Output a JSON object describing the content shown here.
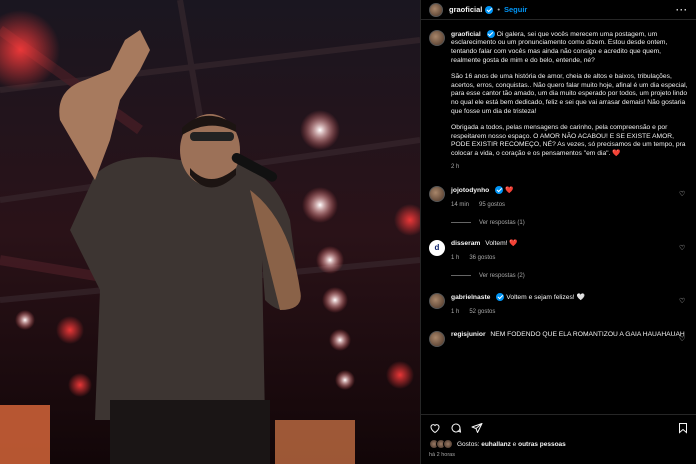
{
  "header": {
    "username": "graoficial",
    "separator": "•",
    "follow_label": "Seguir",
    "more_label": "···"
  },
  "caption": {
    "username": "graoficial",
    "paragraphs": [
      "Oi galera, sei que vocês merecem uma postagem, um esclarecimento ou um pronunciamento como dizem. Estou desde ontem, tentando falar com vocês mas ainda não consigo e acredito que quem, realmente gosta de mim e do belo, entende, né?",
      "São 16 anos de uma história de amor, cheia de altos e baixos, tribulações, acertos, erros, conquistas.. Não quero falar muito hoje, afinal é um dia especial, para esse cantor tão amado, um dia muito esperado por todos, um projeto lindo no qual ele está bem dedicado, feliz e sei que vai arrasar demais! Não gostaria que fosse um dia de tristeza!",
      "Obrigada a todos, pelas mensagens de carinho, pela compreensão e por respeitarem nosso espaço. O AMOR NÃO ACABOU! E SE EXISTE AMOR, PODE EXISTIR RECOMEÇO, NÉ? As vezes, só precisamos de um tempo, pra colocar a vida, o coração e os pensamentos \"em dia\". ❤️"
    ],
    "time": "2 h"
  },
  "comments": [
    {
      "user": "jojotodynho",
      "verified": true,
      "text": "❤️",
      "time": "14 min",
      "likes": "95 gostos",
      "replies": "Ver respostas (1)"
    },
    {
      "user": "disseram",
      "verified": false,
      "text": "Voltem! ❤️",
      "time": "1 h",
      "likes": "36 gostos",
      "replies": "Ver respostas (2)"
    },
    {
      "user": "gabrielnaste",
      "verified": true,
      "text": "Voltem e sejam felizes! 🤍",
      "time": "1 h",
      "likes": "52 gostos"
    },
    {
      "user": "regisjunior",
      "verified": false,
      "text": "NEM FODENDO QUE ELA ROMANTIZOU A GAIA HAUAHAUAH"
    }
  ],
  "footer": {
    "likes_prefix": "Gostos:",
    "likes_user": "euhallanz",
    "likes_suffix": "e",
    "likes_others": "outras pessoas",
    "post_time": "há 2 horas"
  },
  "icons": [
    "heart-icon",
    "comment-icon",
    "share-icon",
    "bookmark-icon",
    "verified-badge-icon",
    "more-icon"
  ],
  "colors": {
    "accent": "#0095f6",
    "like_red": "#ff3040",
    "background": "#000000",
    "muted": "#a8a8a8"
  }
}
